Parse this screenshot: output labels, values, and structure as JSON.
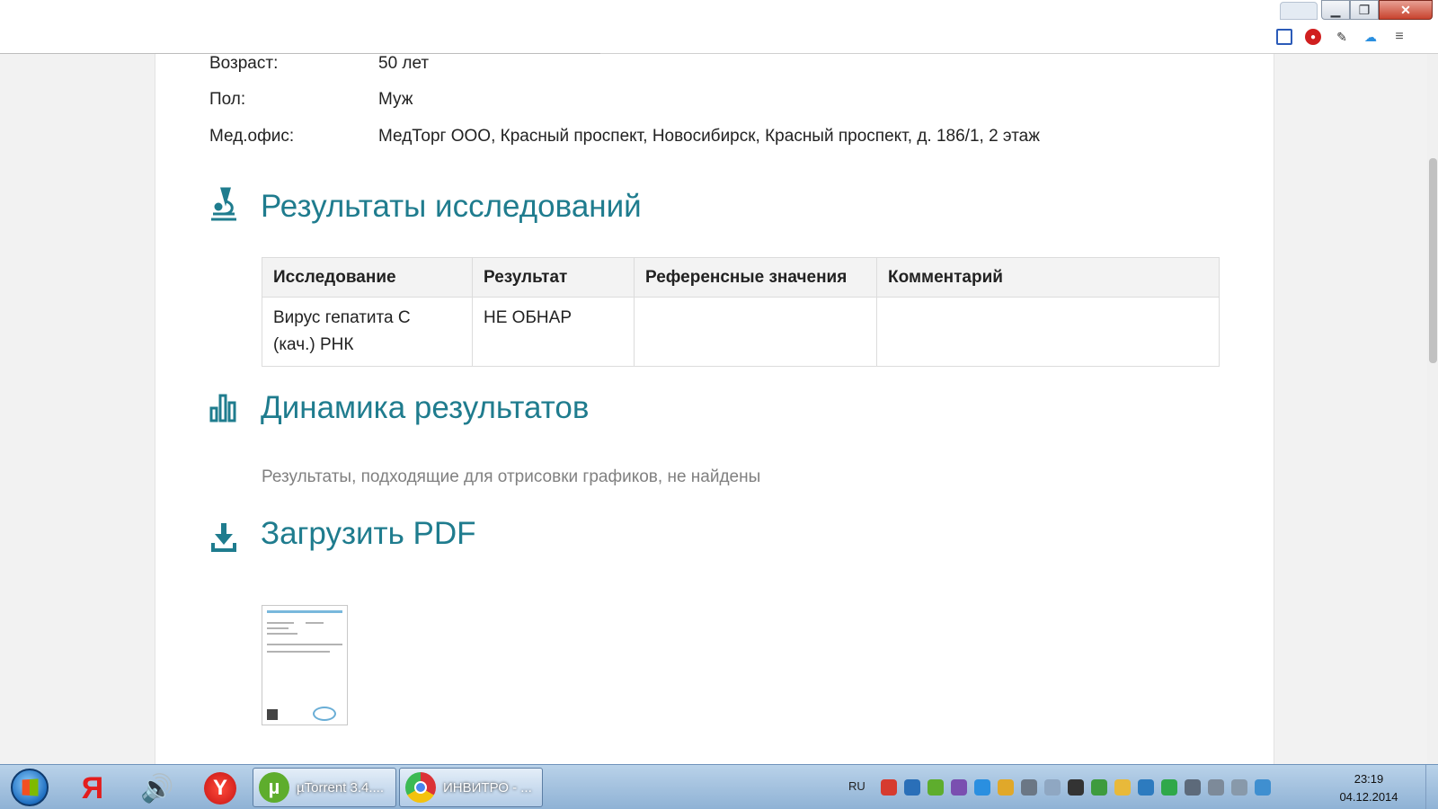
{
  "window": {
    "min_glyph": "▁",
    "max_glyph": "❐",
    "close_glyph": "✕"
  },
  "toolbar": {
    "icons": [
      "apps-grid-icon",
      "adblock-icon",
      "evernote-icon",
      "cloud-icon",
      "menu-icon"
    ],
    "menu_glyph": "≡"
  },
  "patient": {
    "age_label": "Возраст:",
    "age_value": "50 лет",
    "sex_label": "Пол:",
    "sex_value": "Муж",
    "office_label": "Мед.офис:",
    "office_value": "МедТорг ООО, Красный проспект, Новосибирск, Красный проспект, д. 186/1, 2 этаж"
  },
  "results": {
    "title": "Результаты исследований",
    "headers": [
      "Исследование",
      "Результат",
      "Референсные значения",
      "Комментарий"
    ],
    "rows": [
      {
        "test_line1": "Вирус гепатита С",
        "test_line2": "(кач.) РНК",
        "result": "НЕ ОБНАР",
        "reference": "",
        "comment": ""
      }
    ]
  },
  "dynamics": {
    "title": "Динамика результатов",
    "empty_text": "Результаты, подходящие для отрисовки графиков, не найдены"
  },
  "pdf": {
    "title": "Загрузить PDF"
  },
  "taskbar": {
    "yandex_glyph": "Я",
    "sound_glyph": "🔊",
    "yabrowser_glyph": "Y",
    "utorrent_glyph": "µ",
    "utorrent_label": "µTorrent 3.4....",
    "chrome_label": "ИНВИТРО - ...",
    "lang": "RU",
    "time": "23:19",
    "date": "04.12.2014"
  },
  "colors": {
    "accent": "#1f7c8e",
    "muted_text": "#808080"
  }
}
